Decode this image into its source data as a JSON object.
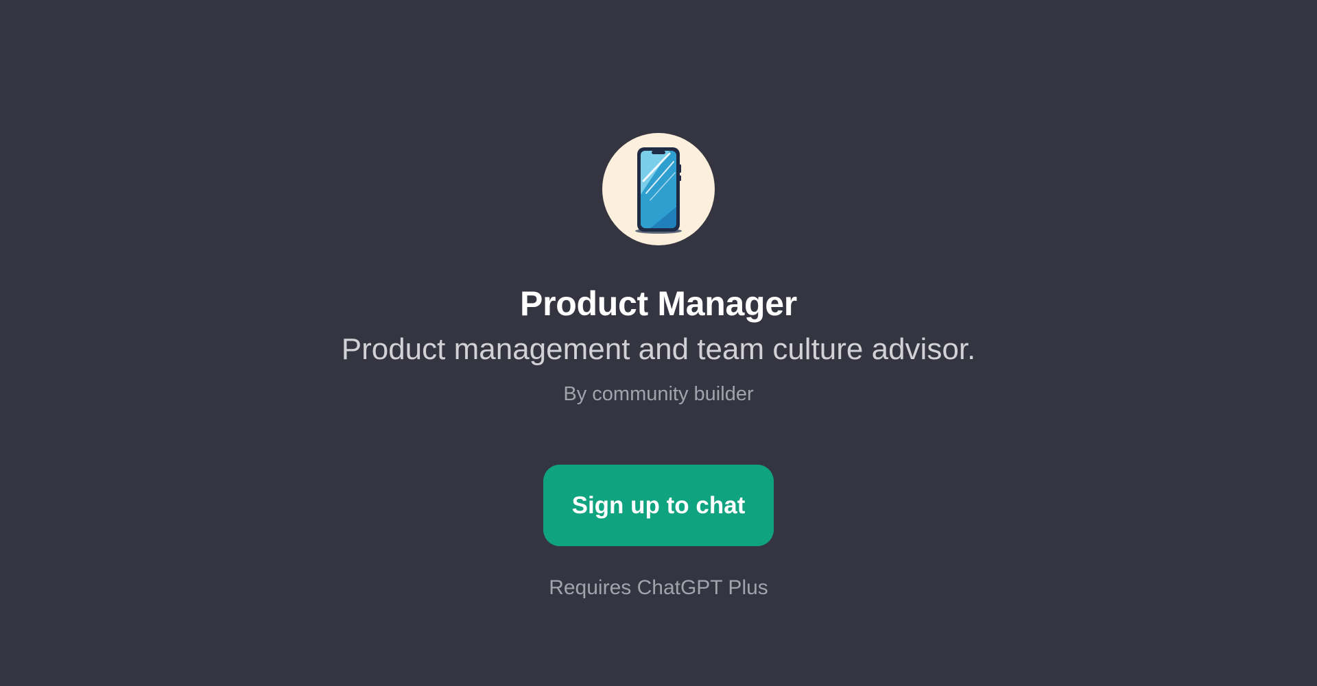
{
  "app": {
    "avatar_icon": "smartphone-icon",
    "title": "Product Manager",
    "description": "Product management and team culture advisor.",
    "author": "By community builder",
    "cta_label": "Sign up to chat",
    "requirement_note": "Requires ChatGPT Plus"
  },
  "colors": {
    "background": "#343541",
    "avatar_background": "#fcefdc",
    "cta_background": "#10a37f",
    "title_text": "#ffffff",
    "muted_text": "#a3a3ad"
  }
}
